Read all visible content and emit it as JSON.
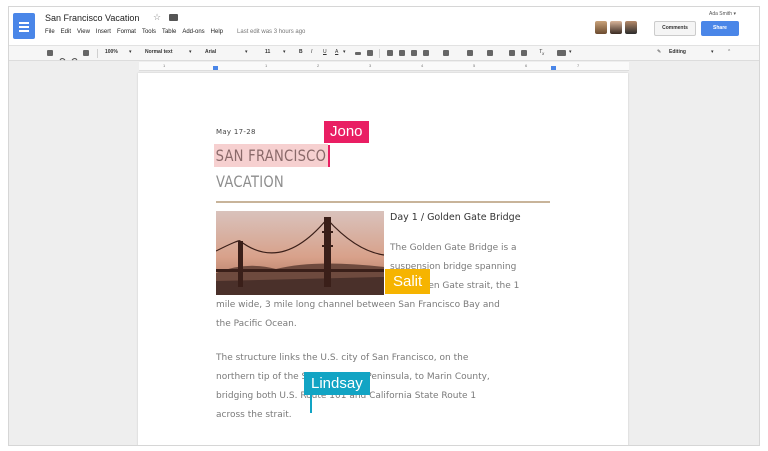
{
  "app": {
    "doc_title": "San Francisco Vacation",
    "user_name": "Ada Smith ▾",
    "menu": [
      "File",
      "Edit",
      "View",
      "Insert",
      "Format",
      "Tools",
      "Table",
      "Add-ons",
      "Help"
    ],
    "last_edit": "Last edit was 3 hours ago",
    "comments_label": "Comments",
    "share_label": "Share",
    "accent_color": "#4a86e8"
  },
  "toolbar": {
    "zoom": "100%",
    "style": "Normal text",
    "font": "Arial",
    "size": "11",
    "bold": "B",
    "italic": "I",
    "underline": "U",
    "text_color": "A",
    "mode": "Editing"
  },
  "ruler": {
    "numbers": [
      "1",
      "1",
      "2",
      "3",
      "4",
      "5",
      "6",
      "7"
    ]
  },
  "document": {
    "date": "May 17-28",
    "heading_line1": "SAN FRANCISCO",
    "heading_line2": "VACATION",
    "day_heading": "Day 1 / Golden Gate Bridge",
    "para1_lines": [
      "The Golden Gate Bridge is a",
      "suspension bridge spanning",
      "the Golden Gate strait, the 1",
      "mile wide, 3 mile long channel between San Francisco Bay and",
      "the Pacific Ocean."
    ],
    "para2_lines": [
      "The structure links the U.S. city of San Francisco, on the",
      "northern tip of the San Francisco Peninsula, to Marin County,",
      "bridging both U.S. Route 101 and California State Route 1",
      "across the strait."
    ]
  },
  "collaborators": [
    {
      "name": "Jono",
      "color": "#e91e63"
    },
    {
      "name": "Salit",
      "color": "#f6b400"
    },
    {
      "name": "Lindsay",
      "color": "#12a4c4"
    }
  ]
}
